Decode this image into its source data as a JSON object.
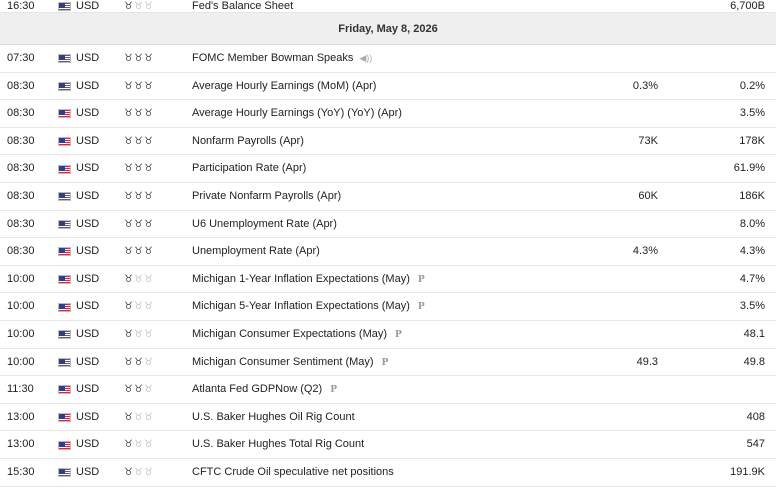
{
  "top_row": {
    "time": "16:30",
    "currency": "USD",
    "event": "Fed's Balance Sheet",
    "forecast": "",
    "previous": "6,700B",
    "importance": 1
  },
  "date_header": "Friday, May 8, 2026",
  "rows": [
    {
      "time": "07:30",
      "currency": "USD",
      "event": "FOMC Member Bowman Speaks",
      "forecast": "",
      "previous": "",
      "importance": 3,
      "marker": "speaker"
    },
    {
      "time": "08:30",
      "currency": "USD",
      "event": "Average Hourly Earnings (MoM) (Apr)",
      "forecast": "0.3%",
      "previous": "0.2%",
      "importance": 3,
      "marker": ""
    },
    {
      "time": "08:30",
      "currency": "USD",
      "event": "Average Hourly Earnings (YoY) (YoY) (Apr)",
      "forecast": "",
      "previous": "3.5%",
      "importance": 3,
      "marker": ""
    },
    {
      "time": "08:30",
      "currency": "USD",
      "event": "Nonfarm Payrolls (Apr)",
      "forecast": "73K",
      "previous": "178K",
      "importance": 3,
      "marker": ""
    },
    {
      "time": "08:30",
      "currency": "USD",
      "event": "Participation Rate (Apr)",
      "forecast": "",
      "previous": "61.9%",
      "importance": 3,
      "marker": ""
    },
    {
      "time": "08:30",
      "currency": "USD",
      "event": "Private Nonfarm Payrolls (Apr)",
      "forecast": "60K",
      "previous": "186K",
      "importance": 3,
      "marker": ""
    },
    {
      "time": "08:30",
      "currency": "USD",
      "event": "U6 Unemployment Rate (Apr)",
      "forecast": "",
      "previous": "8.0%",
      "importance": 3,
      "marker": ""
    },
    {
      "time": "08:30",
      "currency": "USD",
      "event": "Unemployment Rate (Apr)",
      "forecast": "4.3%",
      "previous": "4.3%",
      "importance": 3,
      "marker": ""
    },
    {
      "time": "10:00",
      "currency": "USD",
      "event": "Michigan 1-Year Inflation Expectations (May)",
      "forecast": "",
      "previous": "4.7%",
      "importance": 1,
      "marker": "P"
    },
    {
      "time": "10:00",
      "currency": "USD",
      "event": "Michigan 5-Year Inflation Expectations (May)",
      "forecast": "",
      "previous": "3.5%",
      "importance": 1,
      "marker": "P"
    },
    {
      "time": "10:00",
      "currency": "USD",
      "event": "Michigan Consumer Expectations (May)",
      "forecast": "",
      "previous": "48.1",
      "importance": 1,
      "marker": "P"
    },
    {
      "time": "10:00",
      "currency": "USD",
      "event": "Michigan Consumer Sentiment (May)",
      "forecast": "49.3",
      "previous": "49.8",
      "importance": 2,
      "marker": "P"
    },
    {
      "time": "11:30",
      "currency": "USD",
      "event": "Atlanta Fed GDPNow (Q2)",
      "forecast": "",
      "previous": "",
      "importance": 2,
      "marker": "P"
    },
    {
      "time": "13:00",
      "currency": "USD",
      "event": "U.S. Baker Hughes Oil Rig Count",
      "forecast": "",
      "previous": "408",
      "importance": 1,
      "marker": ""
    },
    {
      "time": "13:00",
      "currency": "USD",
      "event": "U.S. Baker Hughes Total Rig Count",
      "forecast": "",
      "previous": "547",
      "importance": 1,
      "marker": ""
    },
    {
      "time": "15:30",
      "currency": "USD",
      "event": "CFTC Crude Oil speculative net positions",
      "forecast": "",
      "previous": "191.9K",
      "importance": 1,
      "marker": ""
    }
  ]
}
